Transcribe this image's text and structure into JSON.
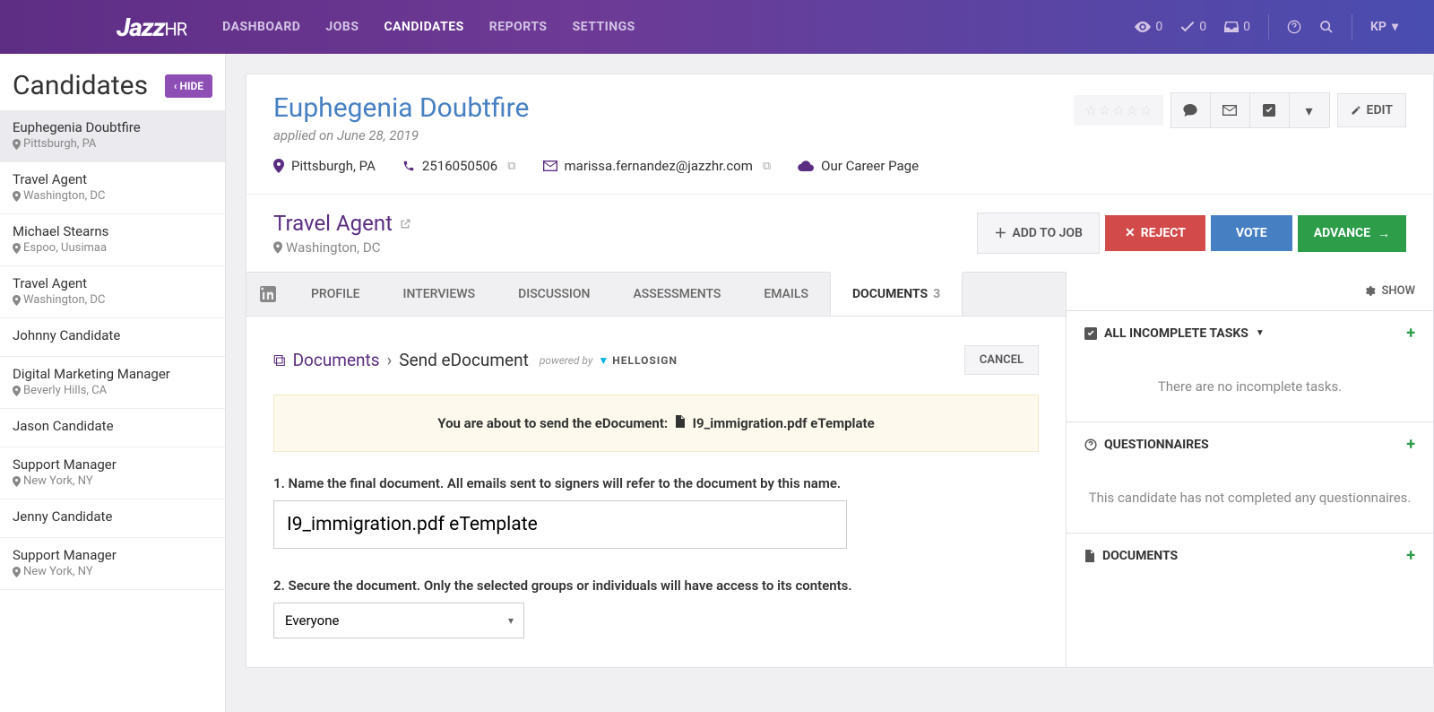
{
  "nav": {
    "logo": "Jazz",
    "logo_suffix": "HR",
    "links": [
      "DASHBOARD",
      "JOBS",
      "CANDIDATES",
      "REPORTS",
      "SETTINGS"
    ],
    "active_index": 2,
    "views_count": "0",
    "checks_count": "0",
    "inbox_count": "0",
    "user": "KP"
  },
  "sidebar": {
    "title": "Candidates",
    "hide_label": "HIDE",
    "items": [
      {
        "name": "Euphegenia Doubtfire",
        "loc": "Pittsburgh, PA",
        "selected": true
      },
      {
        "name": "Travel Agent",
        "loc": "Washington, DC"
      },
      {
        "name": "Michael Stearns",
        "loc": "Espoo, Uusimaa"
      },
      {
        "name": "Travel Agent",
        "loc": "Washington, DC"
      },
      {
        "name": "Johnny Candidate",
        "loc": ""
      },
      {
        "name": "Digital Marketing Manager",
        "loc": "Beverly Hills, CA"
      },
      {
        "name": "Jason Candidate",
        "loc": ""
      },
      {
        "name": "Support Manager",
        "loc": "New York, NY"
      },
      {
        "name": "Jenny Candidate",
        "loc": ""
      },
      {
        "name": "Support Manager",
        "loc": "New York, NY"
      }
    ]
  },
  "profile": {
    "name": "Euphegenia Doubtfire",
    "applied": "applied on June 28, 2019",
    "location": "Pittsburgh, PA",
    "phone": "2516050506",
    "email": "marissa.fernandez@jazzhr.com",
    "source": "Our Career Page",
    "edit_label": "EDIT",
    "job_title": "Travel Agent",
    "job_loc": "Washington, DC",
    "add_job": "ADD TO JOB",
    "reject": "REJECT",
    "vote": "VOTE",
    "advance": "ADVANCE"
  },
  "tabs": {
    "items": [
      "PROFILE",
      "INTERVIEWS",
      "DISCUSSION",
      "ASSESSMENTS",
      "EMAILS",
      "DOCUMENTS"
    ],
    "active_index": 5,
    "doc_count": "3"
  },
  "docs": {
    "bc_link": "Documents",
    "bc_current": "Send eDocument",
    "powered_by": "powered by",
    "hellosign": "HELLOSIGN",
    "cancel": "CANCEL",
    "notice_prefix": "You are about to send the eDocument:",
    "notice_file": "I9_immigration.pdf eTemplate",
    "step1": "1. Name the final document. All emails sent to signers will refer to the document by this name.",
    "doc_name_value": "I9_immigration.pdf eTemplate",
    "step2": "2. Secure the document. Only the selected groups or individuals will have access to its contents.",
    "security_value": "Everyone"
  },
  "right": {
    "show": "SHOW",
    "tasks_title": "ALL INCOMPLETE TASKS",
    "tasks_empty": "There are no incomplete tasks.",
    "quest_title": "QUESTIONNAIRES",
    "quest_empty": "This candidate has not completed any questionnaires.",
    "docs_title": "DOCUMENTS"
  }
}
